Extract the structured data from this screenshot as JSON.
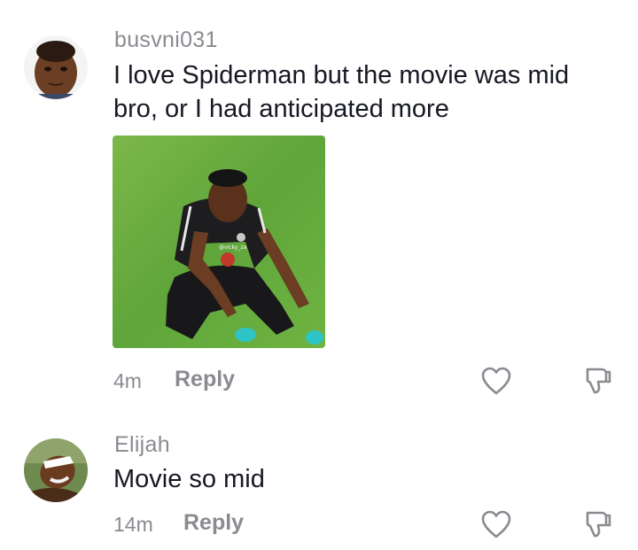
{
  "comments": [
    {
      "username": "busvni031",
      "text_line1": "I love Spiderman but the movie was mid",
      "text_line2": "bro, or I had anticipated more",
      "time": "4m",
      "reply_label": "Reply",
      "has_photo": true,
      "photo_watermark": "@vicky_za"
    },
    {
      "username": "Elijah",
      "text_line1": "Movie so mid",
      "time": "14m",
      "reply_label": "Reply"
    }
  ],
  "icons": {
    "like": "heart-icon",
    "dislike": "thumbs-down-icon"
  }
}
